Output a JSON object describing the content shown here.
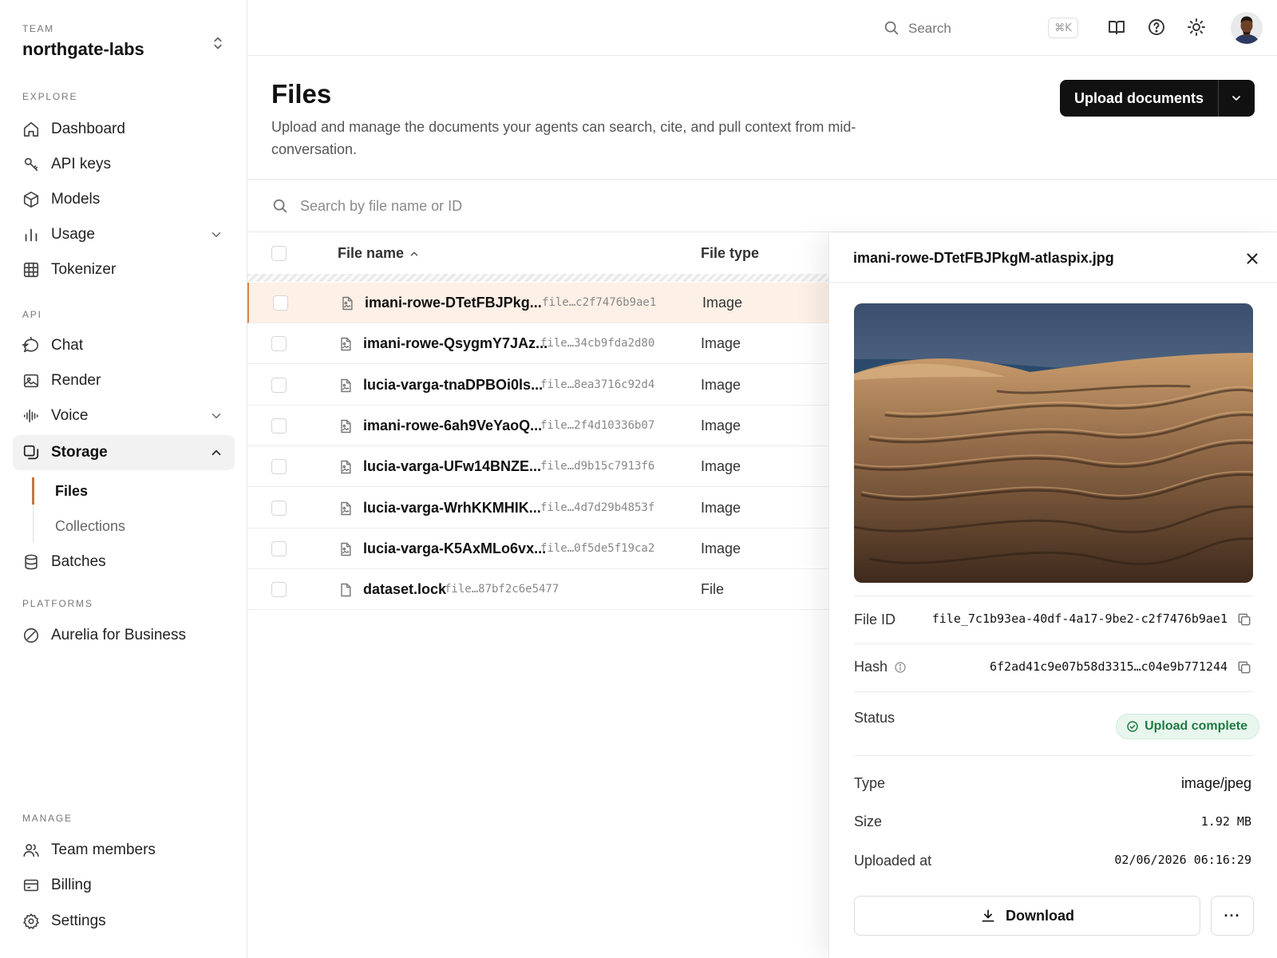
{
  "sidebar": {
    "team_label": "TEAM",
    "team_name": "northgate-labs",
    "sections": {
      "explore": "EXPLORE",
      "api": "API",
      "platforms": "PLATFORMS",
      "manage": "MANAGE"
    },
    "items": {
      "dashboard": "Dashboard",
      "api_keys": "API keys",
      "models": "Models",
      "usage": "Usage",
      "tokenizer": "Tokenizer",
      "chat": "Chat",
      "render": "Render",
      "voice": "Voice",
      "storage": "Storage",
      "files": "Files",
      "collections": "Collections",
      "batches": "Batches",
      "aurelia": "Aurelia for Business",
      "team_members": "Team members",
      "billing": "Billing",
      "settings": "Settings"
    },
    "active_item": "Storage",
    "active_subitem": "Files"
  },
  "topbar": {
    "search_label": "Search",
    "shortcut": "⌘K"
  },
  "page": {
    "title": "Files",
    "description": "Upload and manage the documents your agents can search, cite, and pull context from mid-conversation.",
    "upload_label": "Upload documents"
  },
  "files_search": {
    "placeholder": "Search by file name or ID"
  },
  "table": {
    "col_name": "File name",
    "col_type": "File type",
    "rows": [
      {
        "name": "imani-rowe-DTetFBJPkg...",
        "id": "file…c2f7476b9ae1",
        "type": "Image"
      },
      {
        "name": "imani-rowe-QsygmY7JAz...",
        "id": "file…34cb9fda2d80",
        "type": "Image"
      },
      {
        "name": "lucia-varga-tnaDPBOi0ls...",
        "id": "file…8ea3716c92d4",
        "type": "Image"
      },
      {
        "name": "imani-rowe-6ah9VeYaoQ...",
        "id": "file…2f4d10336b07",
        "type": "Image"
      },
      {
        "name": "lucia-varga-UFw14BNZE...",
        "id": "file…d9b15c7913f6",
        "type": "Image"
      },
      {
        "name": "lucia-varga-WrhKKMHIK...",
        "id": "file…4d7d29b4853f",
        "type": "Image"
      },
      {
        "name": "lucia-varga-K5AxMLo6vx...",
        "id": "file…0f5de5f19ca2",
        "type": "Image"
      },
      {
        "name": "dataset.lock",
        "id": "file…87bf2c6e5477",
        "type": "File"
      }
    ]
  },
  "panel": {
    "title": "imani-rowe-DTetFBJPkgM-atlaspix.jpg",
    "file_id_label": "File ID",
    "file_id": "file_7c1b93ea-40df-4a17-9be2-c2f7476b9ae1",
    "hash_label": "Hash",
    "hash": "6f2ad41c9e07b58d3315…c04e9b771244",
    "status_label": "Status",
    "status": "Upload complete",
    "type_label": "Type",
    "type": "image/jpeg",
    "size_label": "Size",
    "size": "1.92 MB",
    "uploaded_label": "Uploaded at",
    "uploaded": "02/06/2026 06:16:29",
    "download_label": "Download",
    "more_label": "···"
  },
  "colors": {
    "accent": "#c8753f",
    "selected_row": "#fdf0e6",
    "status_green": "#1f7a43",
    "primary_button": "#111111"
  },
  "icons": {
    "dashboard": "home-icon",
    "api_keys": "key-icon",
    "models": "cube-icon",
    "usage": "bar-chart-icon",
    "tokenizer": "grid-icon",
    "chat": "chat-bubble-icon",
    "render": "image-icon",
    "voice": "waveform-icon",
    "storage": "storage-icon",
    "batches": "database-icon",
    "aurelia": "slash-circle-icon",
    "team_members": "users-icon",
    "billing": "credit-card-icon",
    "settings": "gear-icon"
  }
}
